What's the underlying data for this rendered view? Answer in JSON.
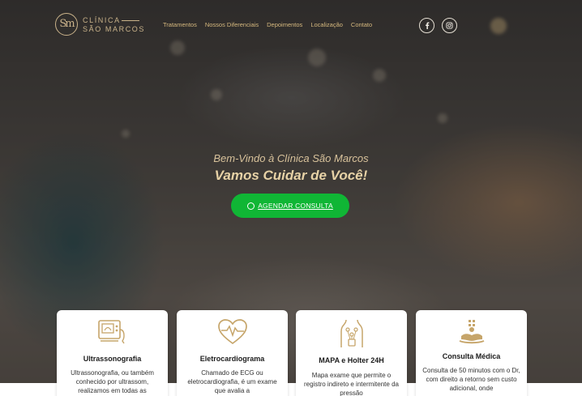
{
  "brand": {
    "monogram": "Sm",
    "line1": "CLÍNICA",
    "line2": "SÃO MARCOS",
    "gold": "#c9b28a"
  },
  "nav": {
    "items": [
      "Tratamentos",
      "Nossos Diferenciais",
      "Depoimentos",
      "Localização",
      "Contato"
    ]
  },
  "social": {
    "facebook_icon": "facebook-icon",
    "instagram_icon": "instagram-icon"
  },
  "hero": {
    "subtitle": "Bem-Vindo à Clínica São Marcos",
    "title": "Vamos Cuidar de Você!",
    "cta_label": "AGENDAR CONSULTA",
    "cta_color": "#10b635"
  },
  "services": [
    {
      "icon": "ultrasound-machine-icon",
      "title": "Ultrassonografia",
      "description": "Ultrassonografia, ou também conhecido por ultrassom, realizamos em todas as"
    },
    {
      "icon": "heart-pulse-icon",
      "title": "Eletrocardiograma",
      "description": "Chamado de ECG ou eletrocardiografia, é um exame que avalia a"
    },
    {
      "icon": "holter-body-icon",
      "title": "MAPA e Holter 24H",
      "description": "Mapa exame que permite o registro indireto e intermitente da pressão"
    },
    {
      "icon": "medical-care-hand-icon",
      "title": "Consulta Médica",
      "description": "Consulta de 50 minutos com o Dr, com direito a retorno sem custo adicional, onde"
    }
  ]
}
